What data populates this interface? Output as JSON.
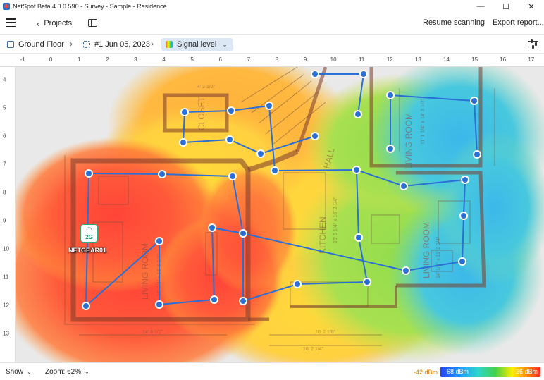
{
  "window": {
    "title": "NetSpot Beta 4.0.0.590 - Survey - Sample - Residence",
    "minimize_glyph": "—",
    "maximize_glyph": "☐",
    "close_glyph": "✕"
  },
  "toolbar": {
    "projects_label": "Projects",
    "resume_label": "Resume scanning",
    "export_label": "Export report..."
  },
  "breadcrumb": {
    "floor": "Ground Floor",
    "snapshot": "#1 Jun 05, 2023",
    "view": "Signal level"
  },
  "ruler": {
    "x_ticks": [
      "-1",
      "0",
      "1",
      "2",
      "3",
      "4",
      "5",
      "6",
      "7",
      "8",
      "9",
      "10",
      "11",
      "12",
      "13",
      "14",
      "15",
      "16",
      "17"
    ],
    "y_ticks": [
      "4",
      "5",
      "6",
      "7",
      "8",
      "9",
      "10",
      "11",
      "12",
      "13"
    ]
  },
  "map": {
    "room_labels": [
      "CLOSET",
      "HALL",
      "LIVING ROOM",
      "KITCHEN",
      "LIVING ROOM",
      "LIVING ROOM"
    ],
    "dimension_labels": [
      "4' 2 1/2\"",
      "11' 1 1/4\" x 14' 3 1/2\"",
      "16' 5 1/4\" x 16' 2 1/4\"",
      "14' 1/4\" x 11' 2 3/4\"",
      "15' 3/4\" x 15' 6 3/4\"",
      "14' 8 1/2\"",
      "10' 2 1/8\"",
      "16' 2 1/4\""
    ],
    "access_point": {
      "band": "2G",
      "name": "NETGEAR01"
    },
    "heat_colors": {
      "strong": "#ff4a3c",
      "medium": "#ffe23a",
      "fair": "#7fd450",
      "weak": "#3cc4e6"
    },
    "path_color": "#2a6fd6"
  },
  "statusbar": {
    "show_label": "Show",
    "zoom_label": "Zoom: 62%",
    "legend_min": "-42 dBm",
    "legend_start": "-68 dBm",
    "legend_end": "-36 dBm"
  }
}
